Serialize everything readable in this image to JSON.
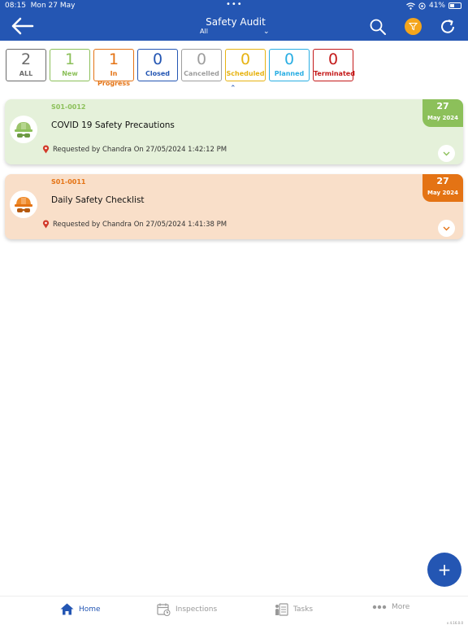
{
  "status_bar": {
    "time": "08:15",
    "date": "Mon 27 May",
    "battery": "41%"
  },
  "header": {
    "title": "Safety Audit",
    "subtitle": "All"
  },
  "colors": {
    "primary": "#2456b3",
    "filter_accent": "#f4a51c",
    "green": "#8cc05a",
    "orange": "#e47314"
  },
  "status_tiles": [
    {
      "count": "2",
      "label": "ALL",
      "color": "#6b6b6b"
    },
    {
      "count": "1",
      "label": "New",
      "color": "#8cc05a"
    },
    {
      "count": "1",
      "label": "In Progress",
      "color": "#e47314"
    },
    {
      "count": "0",
      "label": "Closed",
      "color": "#2456b3"
    },
    {
      "count": "0",
      "label": "Cancelled",
      "color": "#9e9e9e"
    },
    {
      "count": "0",
      "label": "Scheduled",
      "color": "#e7b313"
    },
    {
      "count": "0",
      "label": "Planned",
      "color": "#2aaee3"
    },
    {
      "count": "0",
      "label": "Terminated",
      "color": "#c41a1a"
    }
  ],
  "audits": [
    {
      "code": "S01-0012",
      "title": "COVID 19 Safety Precautions",
      "requested": "Requested by Chandra On  27/05/2024  1:42:12 PM",
      "day": "27",
      "month": "May 2024",
      "icon": "hardhat-goggles-icon"
    },
    {
      "code": "S01-0011",
      "title": "Daily Safety Checklist",
      "requested": "Requested by Chandra On  27/05/2024  1:41:38 PM",
      "day": "27",
      "month": "May 2024",
      "icon": "hardhat-goggles-icon"
    }
  ],
  "fab": {
    "label": "+"
  },
  "bottom_nav": [
    {
      "label": "Home",
      "icon": "home-icon"
    },
    {
      "label": "Inspections",
      "icon": "calendar-icon"
    },
    {
      "label": "Tasks",
      "icon": "tasks-icon"
    },
    {
      "label": "More",
      "icon": "more-icon"
    }
  ],
  "version": "v 4.16.0.0"
}
